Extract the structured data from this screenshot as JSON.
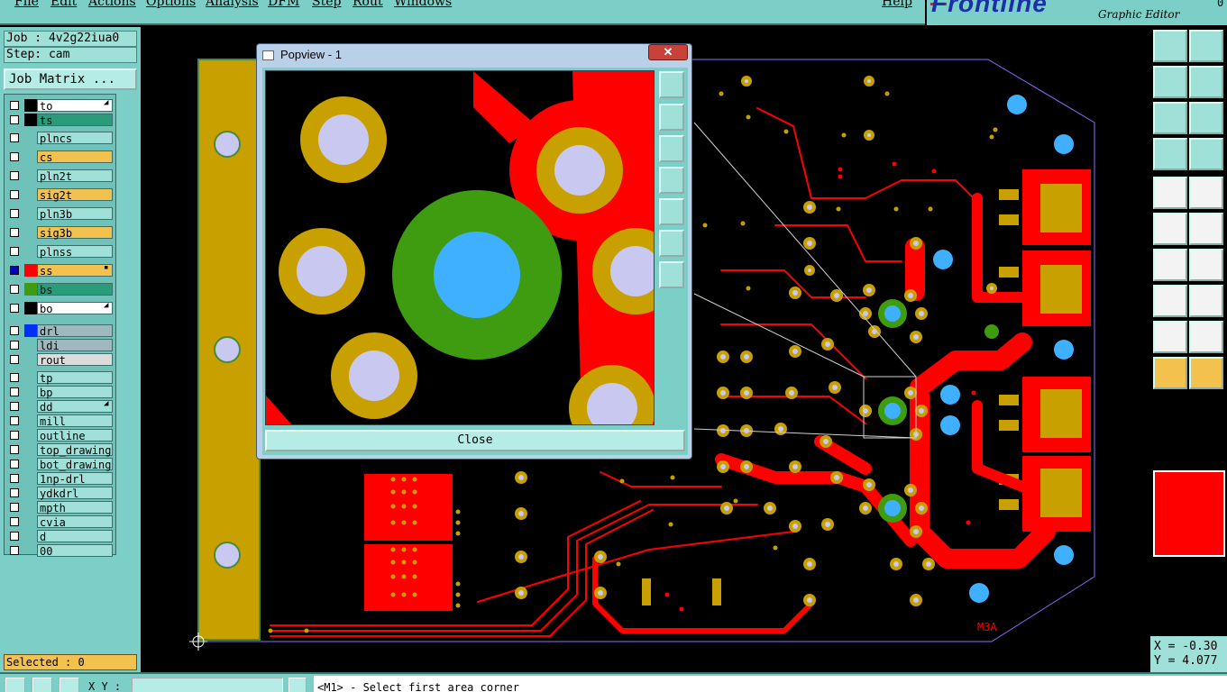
{
  "menu": [
    "File",
    "Edit",
    "Actions",
    "Options",
    "Analysis",
    "DFM",
    "Step",
    "Rout",
    "Windows"
  ],
  "help_label": "Help",
  "logo": {
    "text": "Frontline",
    "subtitle": "Graphic Editor",
    "version_fragment": "0"
  },
  "job_line": "Job : 4v2g22iua0",
  "step_line": "Step: cam",
  "job_matrix_label": "Job Matrix ...",
  "layers": [
    {
      "name": "to",
      "color": "#ffffff",
      "swatch": "#000000",
      "checked": false,
      "mark": "◢"
    },
    {
      "name": "ts",
      "color": "#2a9c7a",
      "swatch": "#000000",
      "checked": false,
      "mark": ""
    },
    {
      "name": "plncs",
      "color": "#9fe0d8",
      "swatch": "",
      "checked": false,
      "mark": ""
    },
    {
      "name": "cs",
      "color": "#f2c14e",
      "swatch": "",
      "checked": false,
      "mark": ""
    },
    {
      "name": "pln2t",
      "color": "#9fe0d8",
      "swatch": "",
      "checked": false,
      "mark": ""
    },
    {
      "name": "sig2t",
      "color": "#f2c14e",
      "swatch": "",
      "checked": false,
      "mark": ""
    },
    {
      "name": "pln3b",
      "color": "#9fe0d8",
      "swatch": "",
      "checked": false,
      "mark": ""
    },
    {
      "name": "sig3b",
      "color": "#f2c14e",
      "swatch": "",
      "checked": false,
      "mark": ""
    },
    {
      "name": "plnss",
      "color": "#9fe0d8",
      "swatch": "",
      "checked": false,
      "mark": ""
    },
    {
      "name": "ss",
      "color": "#f2c14e",
      "swatch": "#ff0000",
      "checked": true,
      "mark": "▪"
    },
    {
      "name": "bs",
      "color": "#2a9c7a",
      "swatch": "#3f9b0f",
      "checked": false,
      "mark": ""
    },
    {
      "name": "bo",
      "color": "#ffffff",
      "swatch": "#000000",
      "checked": false,
      "mark": "◢"
    },
    {
      "name": "drl",
      "color": "#9fb8c0",
      "swatch": "#0030ff",
      "checked": false,
      "mark": ""
    },
    {
      "name": "ldi",
      "color": "#9fb8c0",
      "swatch": "",
      "checked": false,
      "mark": ""
    },
    {
      "name": "rout",
      "color": "#dcdcdc",
      "swatch": "",
      "checked": false,
      "mark": ""
    },
    {
      "name": "tp",
      "color": "#9fe0d8",
      "swatch": "",
      "checked": false,
      "mark": ""
    },
    {
      "name": "bp",
      "color": "#9fe0d8",
      "swatch": "",
      "checked": false,
      "mark": ""
    },
    {
      "name": "dd",
      "color": "#9fe0d8",
      "swatch": "",
      "checked": false,
      "mark": "◢"
    },
    {
      "name": "mill",
      "color": "#9fe0d8",
      "swatch": "",
      "checked": false,
      "mark": ""
    },
    {
      "name": "outline",
      "color": "#9fe0d8",
      "swatch": "",
      "checked": false,
      "mark": ""
    },
    {
      "name": "top_drawing",
      "color": "#9fe0d8",
      "swatch": "",
      "checked": false,
      "mark": ""
    },
    {
      "name": "bot_drawing",
      "color": "#9fe0d8",
      "swatch": "",
      "checked": false,
      "mark": ""
    },
    {
      "name": "1np-drl",
      "color": "#9fe0d8",
      "swatch": "",
      "checked": false,
      "mark": ""
    },
    {
      "name": "ydkdrl",
      "color": "#9fe0d8",
      "swatch": "",
      "checked": false,
      "mark": ""
    },
    {
      "name": "mpth",
      "color": "#9fe0d8",
      "swatch": "",
      "checked": false,
      "mark": ""
    },
    {
      "name": "cvia",
      "color": "#9fe0d8",
      "swatch": "",
      "checked": false,
      "mark": ""
    },
    {
      "name": "d",
      "color": "#9fe0d8",
      "swatch": "",
      "checked": false,
      "mark": ""
    },
    {
      "name": "00",
      "color": "#9fe0d8",
      "swatch": "",
      "checked": false,
      "mark": ""
    }
  ],
  "selected_label": "Selected : 0",
  "popview": {
    "title": "Popview - 1",
    "close_x": "✕",
    "close_button": "Close"
  },
  "coords": {
    "x": "X = -0.30",
    "y": "Y = 4.077"
  },
  "status": {
    "xy_label": "X Y :",
    "xy_value": "",
    "message": "<M1> - Select first area corner"
  },
  "board_label": "M3A",
  "colors": {
    "teal": "#7ccfc6",
    "trace_red": "#ff0000",
    "pad_gold": "#c8a000",
    "pad_lilac": "#c8c8f0",
    "via_blue": "#3fb0ff",
    "ring_green": "#3f9b0f"
  }
}
